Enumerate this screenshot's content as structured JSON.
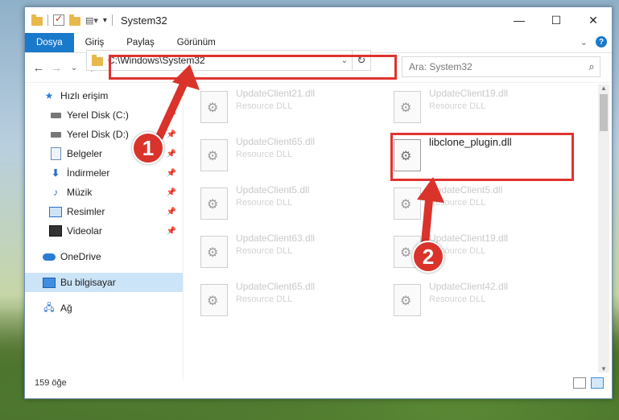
{
  "window": {
    "title": "System32",
    "controls": {
      "minimize": "—",
      "maximize": "☐",
      "close": "✕"
    }
  },
  "ribbon": {
    "tabs": [
      "Dosya",
      "Giriş",
      "Paylaş",
      "Görünüm"
    ],
    "active_tab": "Dosya",
    "help": "?"
  },
  "nav": {
    "back": "←",
    "forward": "→",
    "recent": "⌄",
    "up": "↑"
  },
  "address": {
    "path": "C:\\Windows\\System32",
    "dropdown": "⌄",
    "refresh": "↻"
  },
  "search": {
    "placeholder": "Ara: System32",
    "icon": "🔍"
  },
  "sidebar": {
    "items": [
      {
        "label": "Hızlı erişim",
        "icon": "star-icon",
        "pinned": false
      },
      {
        "label": "Yerel Disk (C:)",
        "icon": "drive-icon",
        "pinned": true
      },
      {
        "label": "Yerel Disk (D:)",
        "icon": "drive-icon",
        "pinned": true
      },
      {
        "label": "Belgeler",
        "icon": "document-icon",
        "pinned": true
      },
      {
        "label": "İndirmeler",
        "icon": "download-icon",
        "pinned": true
      },
      {
        "label": "Müzik",
        "icon": "music-icon",
        "pinned": true
      },
      {
        "label": "Resimler",
        "icon": "pictures-icon",
        "pinned": true
      },
      {
        "label": "Videolar",
        "icon": "video-icon",
        "pinned": true
      },
      {
        "label": "OneDrive",
        "icon": "cloud-icon",
        "pinned": false
      },
      {
        "label": "Bu bilgisayar",
        "icon": "computer-icon",
        "pinned": false,
        "selected": true
      },
      {
        "label": "Ağ",
        "icon": "network-icon",
        "pinned": false
      }
    ]
  },
  "files": [
    {
      "name": "UpdateClient21.dll",
      "type": "Resource DLL"
    },
    {
      "name": "UpdateClient19.dll",
      "type": "Resource DLL"
    },
    {
      "name": "UpdateClient65.dll",
      "type": "Resource DLL"
    },
    {
      "name": "libclone_plugin.dll",
      "type": "",
      "highlighted": true
    },
    {
      "name": "UpdateClient5.dll",
      "type": "Resource DLL"
    },
    {
      "name": "UpdateClient5.dll",
      "type": "Resource DLL"
    },
    {
      "name": "UpdateClient63.dll",
      "type": "Resource DLL"
    },
    {
      "name": "UpdateClient19.dll",
      "type": "Resource DLL"
    },
    {
      "name": "UpdateClient65.dll",
      "type": "Resource DLL"
    },
    {
      "name": "UpdateClient42.dll",
      "type": "Resource DLL"
    }
  ],
  "status": {
    "count": "159 öğe"
  },
  "annotations": {
    "step1": "1",
    "step2": "2",
    "color": "#e0332f"
  }
}
